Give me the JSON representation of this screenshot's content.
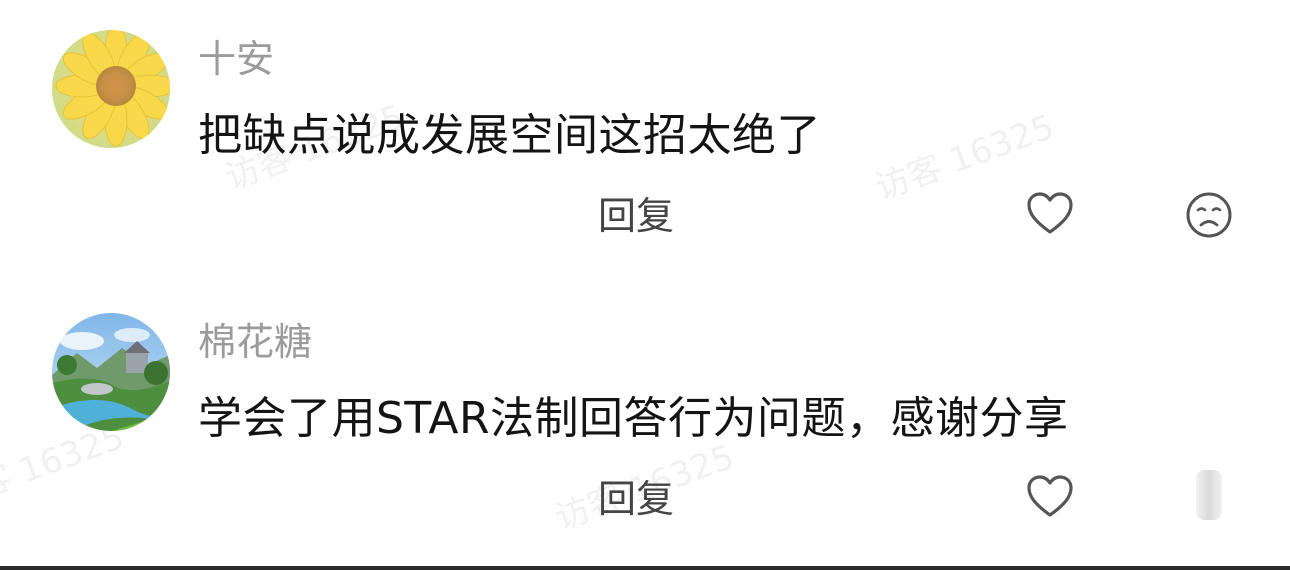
{
  "comments": [
    {
      "username": "十安",
      "text": "把缺点说成发展空间这招太绝了",
      "reply_label": "回复",
      "avatar": "sunflower-avatar"
    },
    {
      "username": "棉花糖",
      "text": "学会了用STAR法制回答行为问题，感谢分享",
      "reply_label": "回复",
      "avatar": "landscape-avatar"
    }
  ],
  "watermark": "访客 16325",
  "icons": {
    "like": "heart-icon",
    "dislike": "sad-face-icon"
  },
  "colors": {
    "username": "#9b9b9b",
    "text": "#141414",
    "reply": "#444444",
    "icon": "#555555"
  }
}
